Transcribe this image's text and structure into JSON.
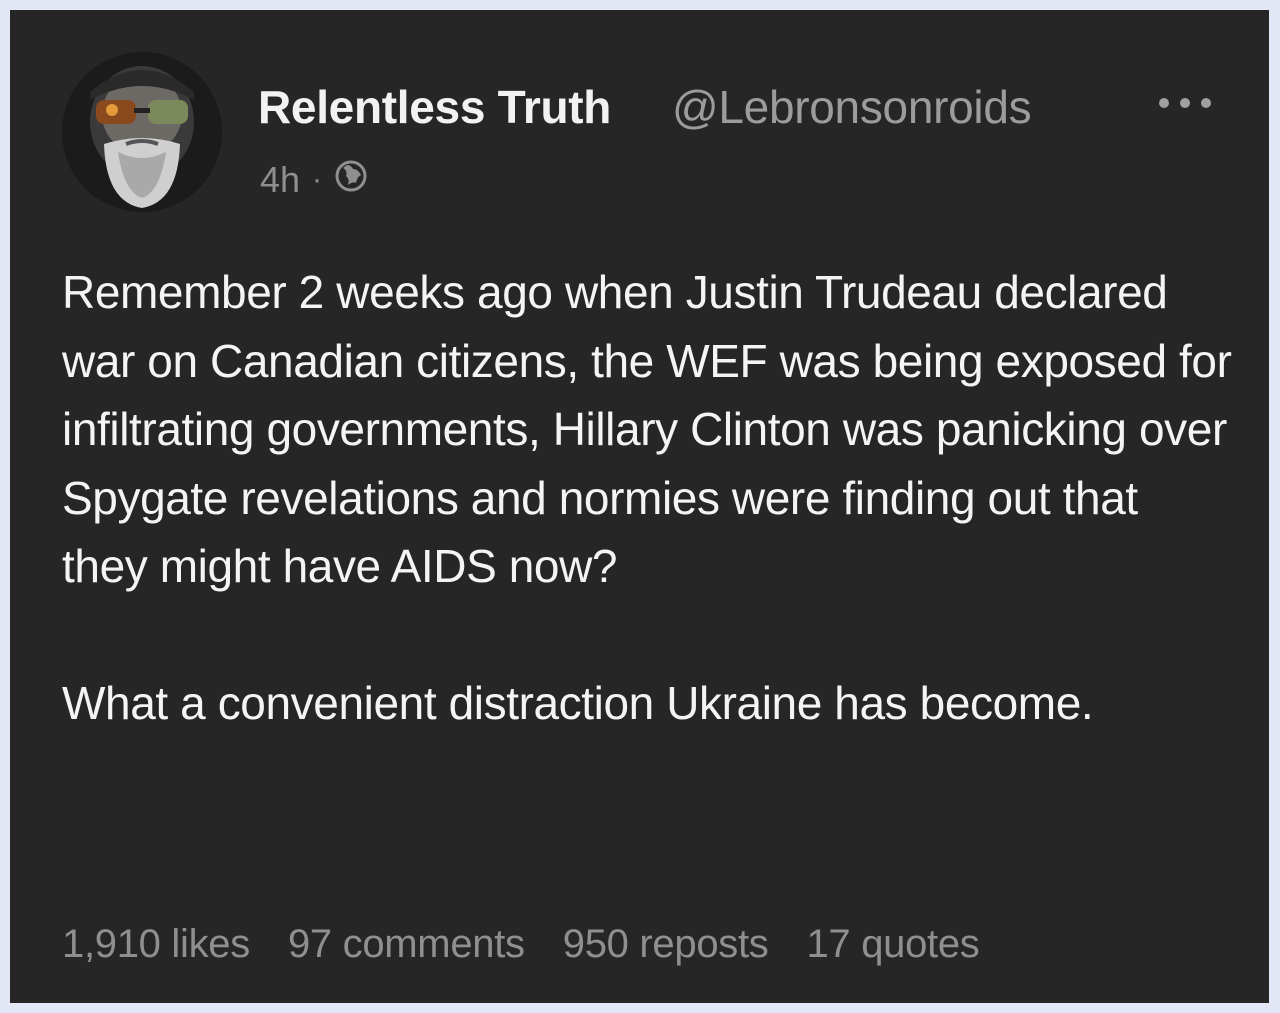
{
  "post": {
    "author": {
      "display_name": "Relentless Truth",
      "handle": "@Lebronsonroids",
      "avatar_icon": "bearded-man-avatar"
    },
    "time": "4h",
    "separator": "·",
    "visibility_icon": "globe-icon",
    "more_icon": "more-options-icon",
    "body": [
      "Remember 2 weeks ago when Justin Trudeau declared war on Canadian citizens, the WEF was being exposed for infiltrating governments, Hillary Clinton was panicking over Spygate revelations and normies were finding out that they might have AIDS now?",
      "What a convenient distraction Ukraine has become."
    ],
    "stats": {
      "likes": "1,910 likes",
      "comments": "97 comments",
      "reposts": "950 reposts",
      "quotes": "17 quotes"
    }
  },
  "colors": {
    "page_background": "#e3e6f5",
    "card_background": "#262626",
    "primary_text": "#f2f2f2",
    "secondary_text": "#9c9c9c"
  }
}
